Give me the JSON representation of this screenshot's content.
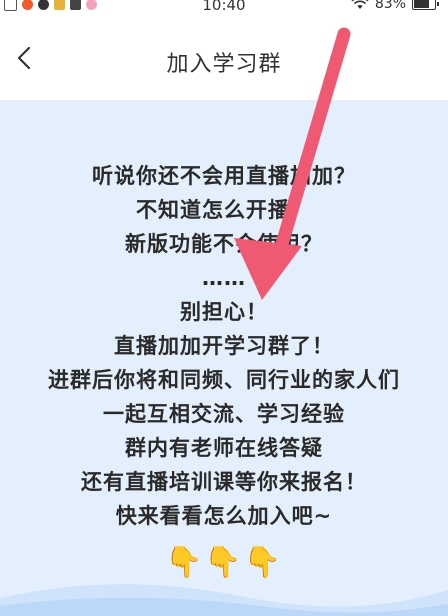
{
  "status_bar": {
    "time": "10:40",
    "battery": "83%"
  },
  "nav": {
    "title": "加入学习群"
  },
  "message": {
    "lines": [
      "听说你还不会用直播加加？",
      "不知道怎么开播？",
      "新版功能不会使用？",
      "……",
      "别担心！",
      "直播加加开学习群了！",
      "进群后你将和同频、同行业的家人们",
      "一起互相交流、学习经验",
      "群内有老师在线答疑",
      "还有直播培训课等你来报名！",
      "快来看看怎么加入吧~"
    ],
    "emoji": "👇👇👇"
  },
  "colors": {
    "content_bg": "#e4effd",
    "arrow": "#ef5a72",
    "wave": "#cfe3fb"
  }
}
